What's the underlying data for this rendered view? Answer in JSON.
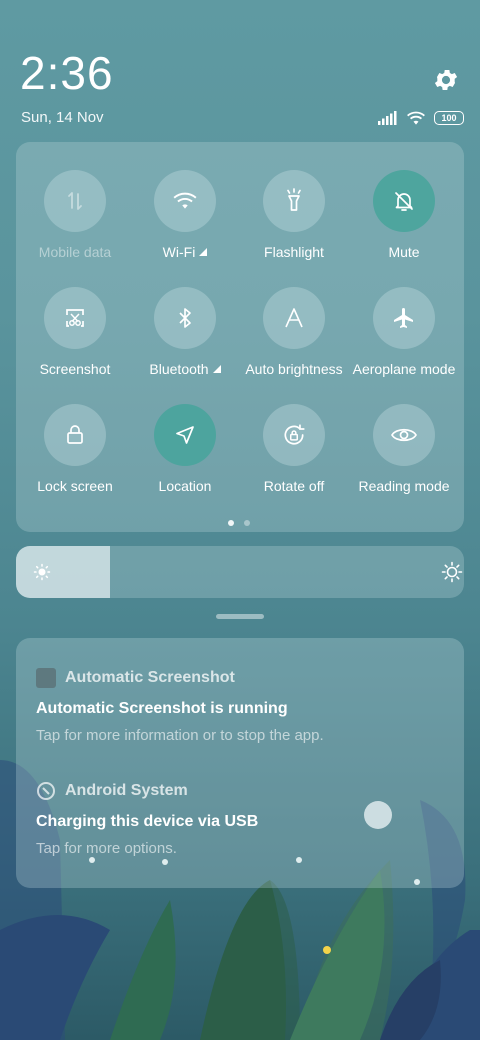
{
  "status": {
    "time": "2:36",
    "date": "Sun, 14 Nov",
    "battery": "100",
    "icons": [
      "signal-icon",
      "wifi-icon",
      "battery-icon"
    ],
    "settings_icon": "gear-icon"
  },
  "quick_settings": {
    "tiles": [
      {
        "label": "Mobile data",
        "icon": "mobile-data-icon",
        "active": false,
        "disabled": true
      },
      {
        "label": "Wi-Fi",
        "icon": "wifi-icon",
        "active": false,
        "has_arrow": true
      },
      {
        "label": "Flashlight",
        "icon": "flashlight-icon",
        "active": false
      },
      {
        "label": "Mute",
        "icon": "bell-off-icon",
        "active": true
      },
      {
        "label": "Screenshot",
        "icon": "scissors-icon",
        "active": false
      },
      {
        "label": "Bluetooth",
        "icon": "bluetooth-icon",
        "active": false,
        "has_arrow": true
      },
      {
        "label": "Auto brightness",
        "icon": "auto-brightness-icon",
        "active": false
      },
      {
        "label": "Aeroplane mode",
        "icon": "airplane-icon",
        "active": false
      },
      {
        "label": "Lock screen",
        "icon": "lock-icon",
        "active": false
      },
      {
        "label": "Location",
        "icon": "location-arrow-icon",
        "active": true
      },
      {
        "label": "Rotate off",
        "icon": "rotate-lock-icon",
        "active": false
      },
      {
        "label": "Reading mode",
        "icon": "eye-icon",
        "active": false
      }
    ],
    "pages": 2,
    "current_page": 1
  },
  "brightness": {
    "level": 0.21
  },
  "notifications": [
    {
      "app": "Automatic Screenshot",
      "title": "Automatic Screenshot is running",
      "text": "Tap for more information or to stop the app."
    },
    {
      "app": "Android System",
      "title": "Charging this device via USB",
      "text": "Tap for more options."
    }
  ],
  "colors": {
    "active_tile": "#46a59b",
    "wallpaper_top": "#5f9aa2",
    "wallpaper_bottom": "#2c5a66"
  }
}
